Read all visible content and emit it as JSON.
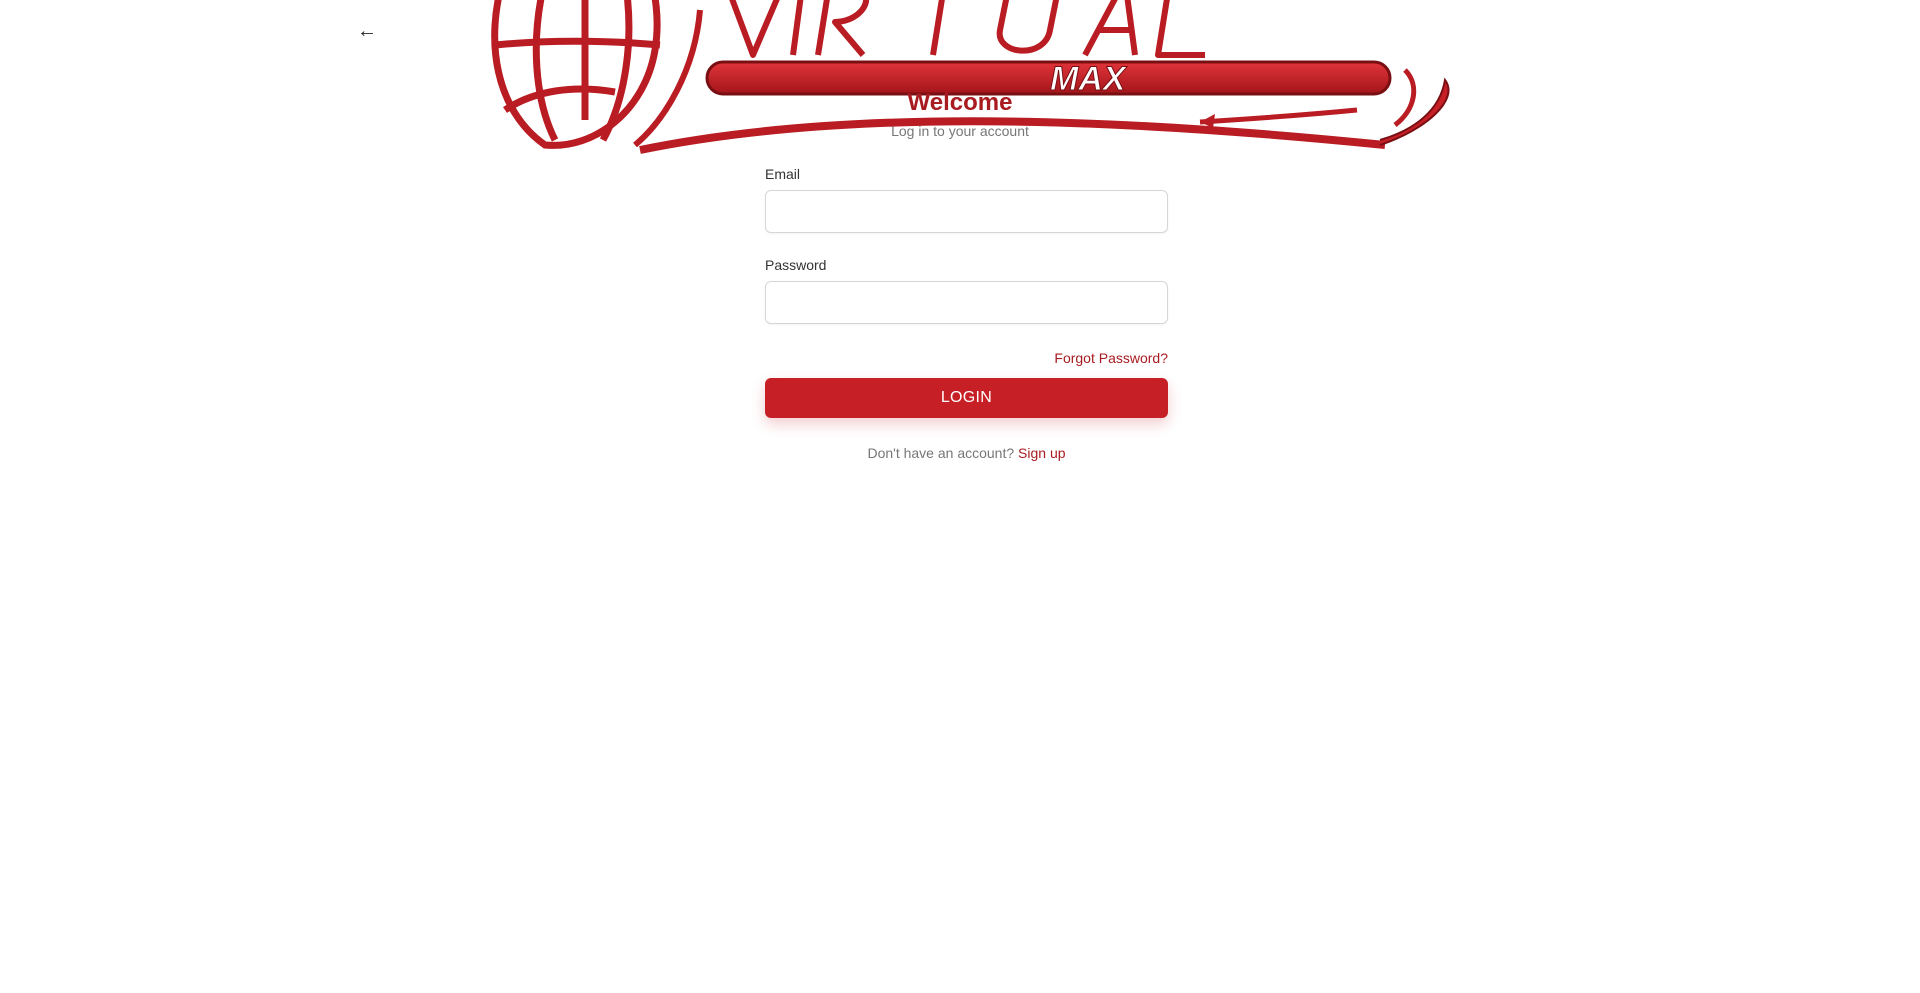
{
  "nav": {
    "back_icon": "←",
    "back_icon_name": "arrow-left-icon"
  },
  "logo": {
    "wordmark": "VIRTUAL",
    "sub": "MAX",
    "colors": {
      "primary": "#c62026",
      "dark": "#7a0f13"
    }
  },
  "header": {
    "title": "Welcome",
    "subtitle": "Log in to your account"
  },
  "form": {
    "email_label": "Email",
    "email_value": "",
    "password_label": "Password",
    "password_value": "",
    "forgot_label": "Forgot Password?",
    "login_label": "LOGIN"
  },
  "footer": {
    "prompt": "Don't have an account?",
    "signup_label": "Sign up"
  },
  "colors": {
    "accent": "#c62026",
    "link": "#a81b20",
    "text_muted": "#777777",
    "background": "#ffffff"
  }
}
